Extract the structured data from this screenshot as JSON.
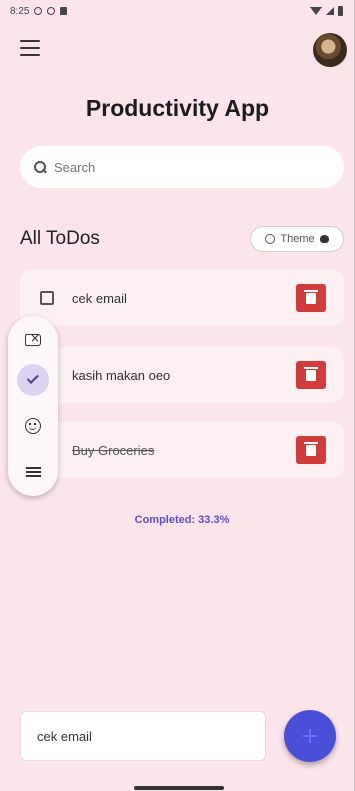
{
  "status_bar": {
    "time": "8:25"
  },
  "header": {
    "title": "Productivity App"
  },
  "search": {
    "placeholder": "Search"
  },
  "section": {
    "title": "All ToDos",
    "theme_label": "Theme"
  },
  "todos": [
    {
      "text": "cek email",
      "completed": false
    },
    {
      "text": "kasih makan oeo",
      "completed": false
    },
    {
      "text": "Buy Groceries",
      "completed": true
    }
  ],
  "stats": {
    "completed_label": "Completed: 33.3%"
  },
  "new_task": {
    "value": "cek email"
  },
  "colors": {
    "accent": "#4a4fd8",
    "delete": "#d23b3b",
    "background": "#fbe4ea"
  },
  "icons": [
    "menu-icon",
    "search-icon",
    "theme-icon",
    "palette-icon",
    "checkbox-icon",
    "trash-icon",
    "backspace-icon",
    "check-icon",
    "smile-icon",
    "lines-icon",
    "plus-icon"
  ]
}
